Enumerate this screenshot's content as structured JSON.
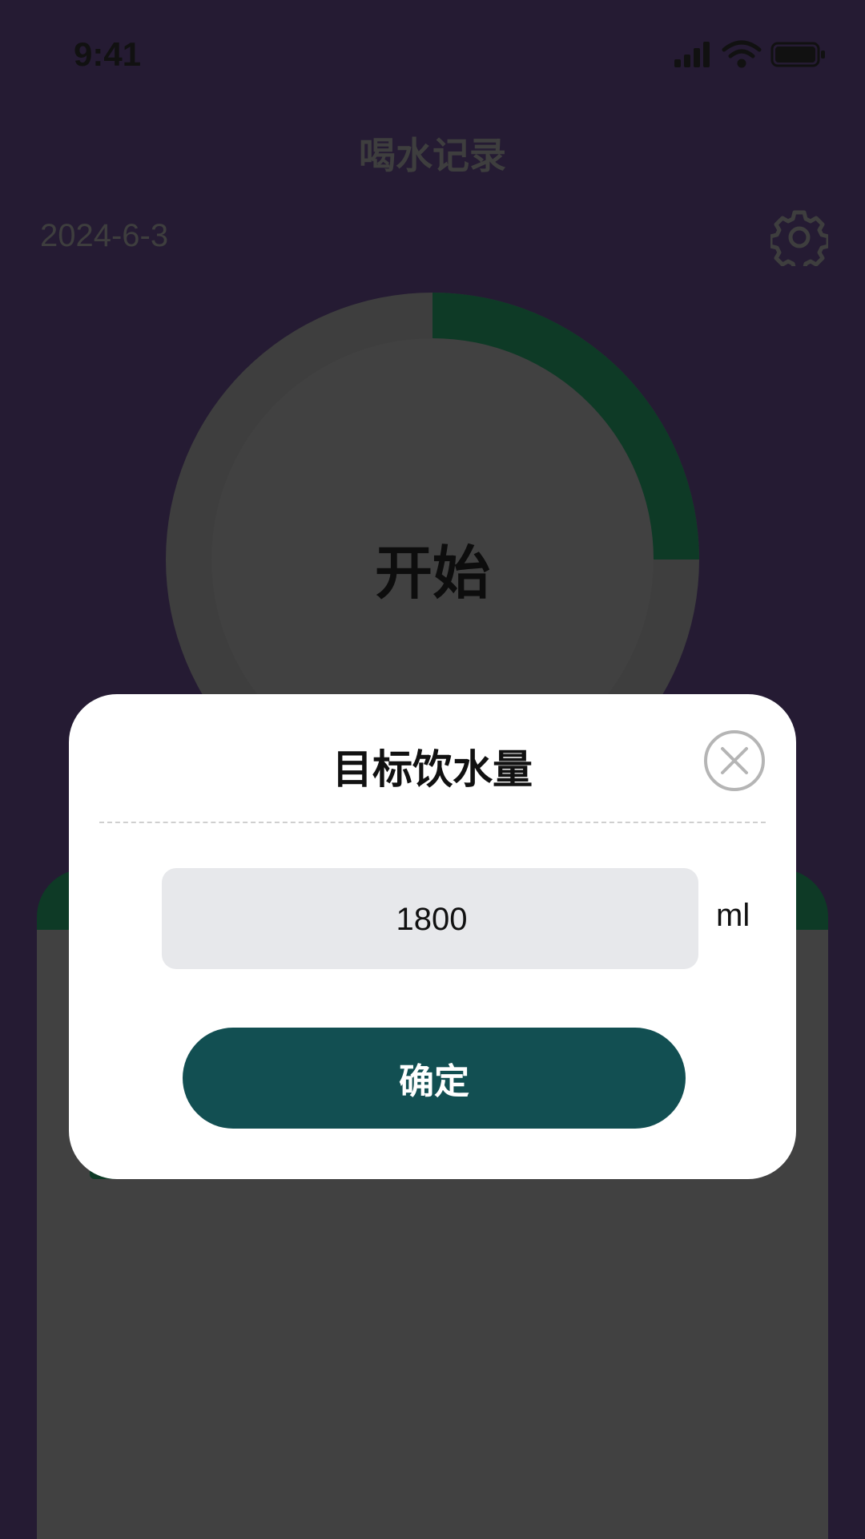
{
  "status_bar": {
    "time": "9:41"
  },
  "header": {
    "title": "喝水记录",
    "date": "2024-6-3"
  },
  "progress": {
    "label": "开始",
    "fraction": 0.25,
    "track_color": "#3e3e3e",
    "fill_color": "#0e3a26"
  },
  "modal": {
    "title": "目标饮水量",
    "input_value": "1800",
    "unit": "ml",
    "confirm_label": "确定"
  },
  "colors": {
    "background": "#251b33",
    "accent": "#124f52",
    "input_bg": "#e7e8eb"
  },
  "icons": [
    "signal-icon",
    "wifi-icon",
    "battery-icon",
    "gear-icon",
    "close-icon"
  ]
}
